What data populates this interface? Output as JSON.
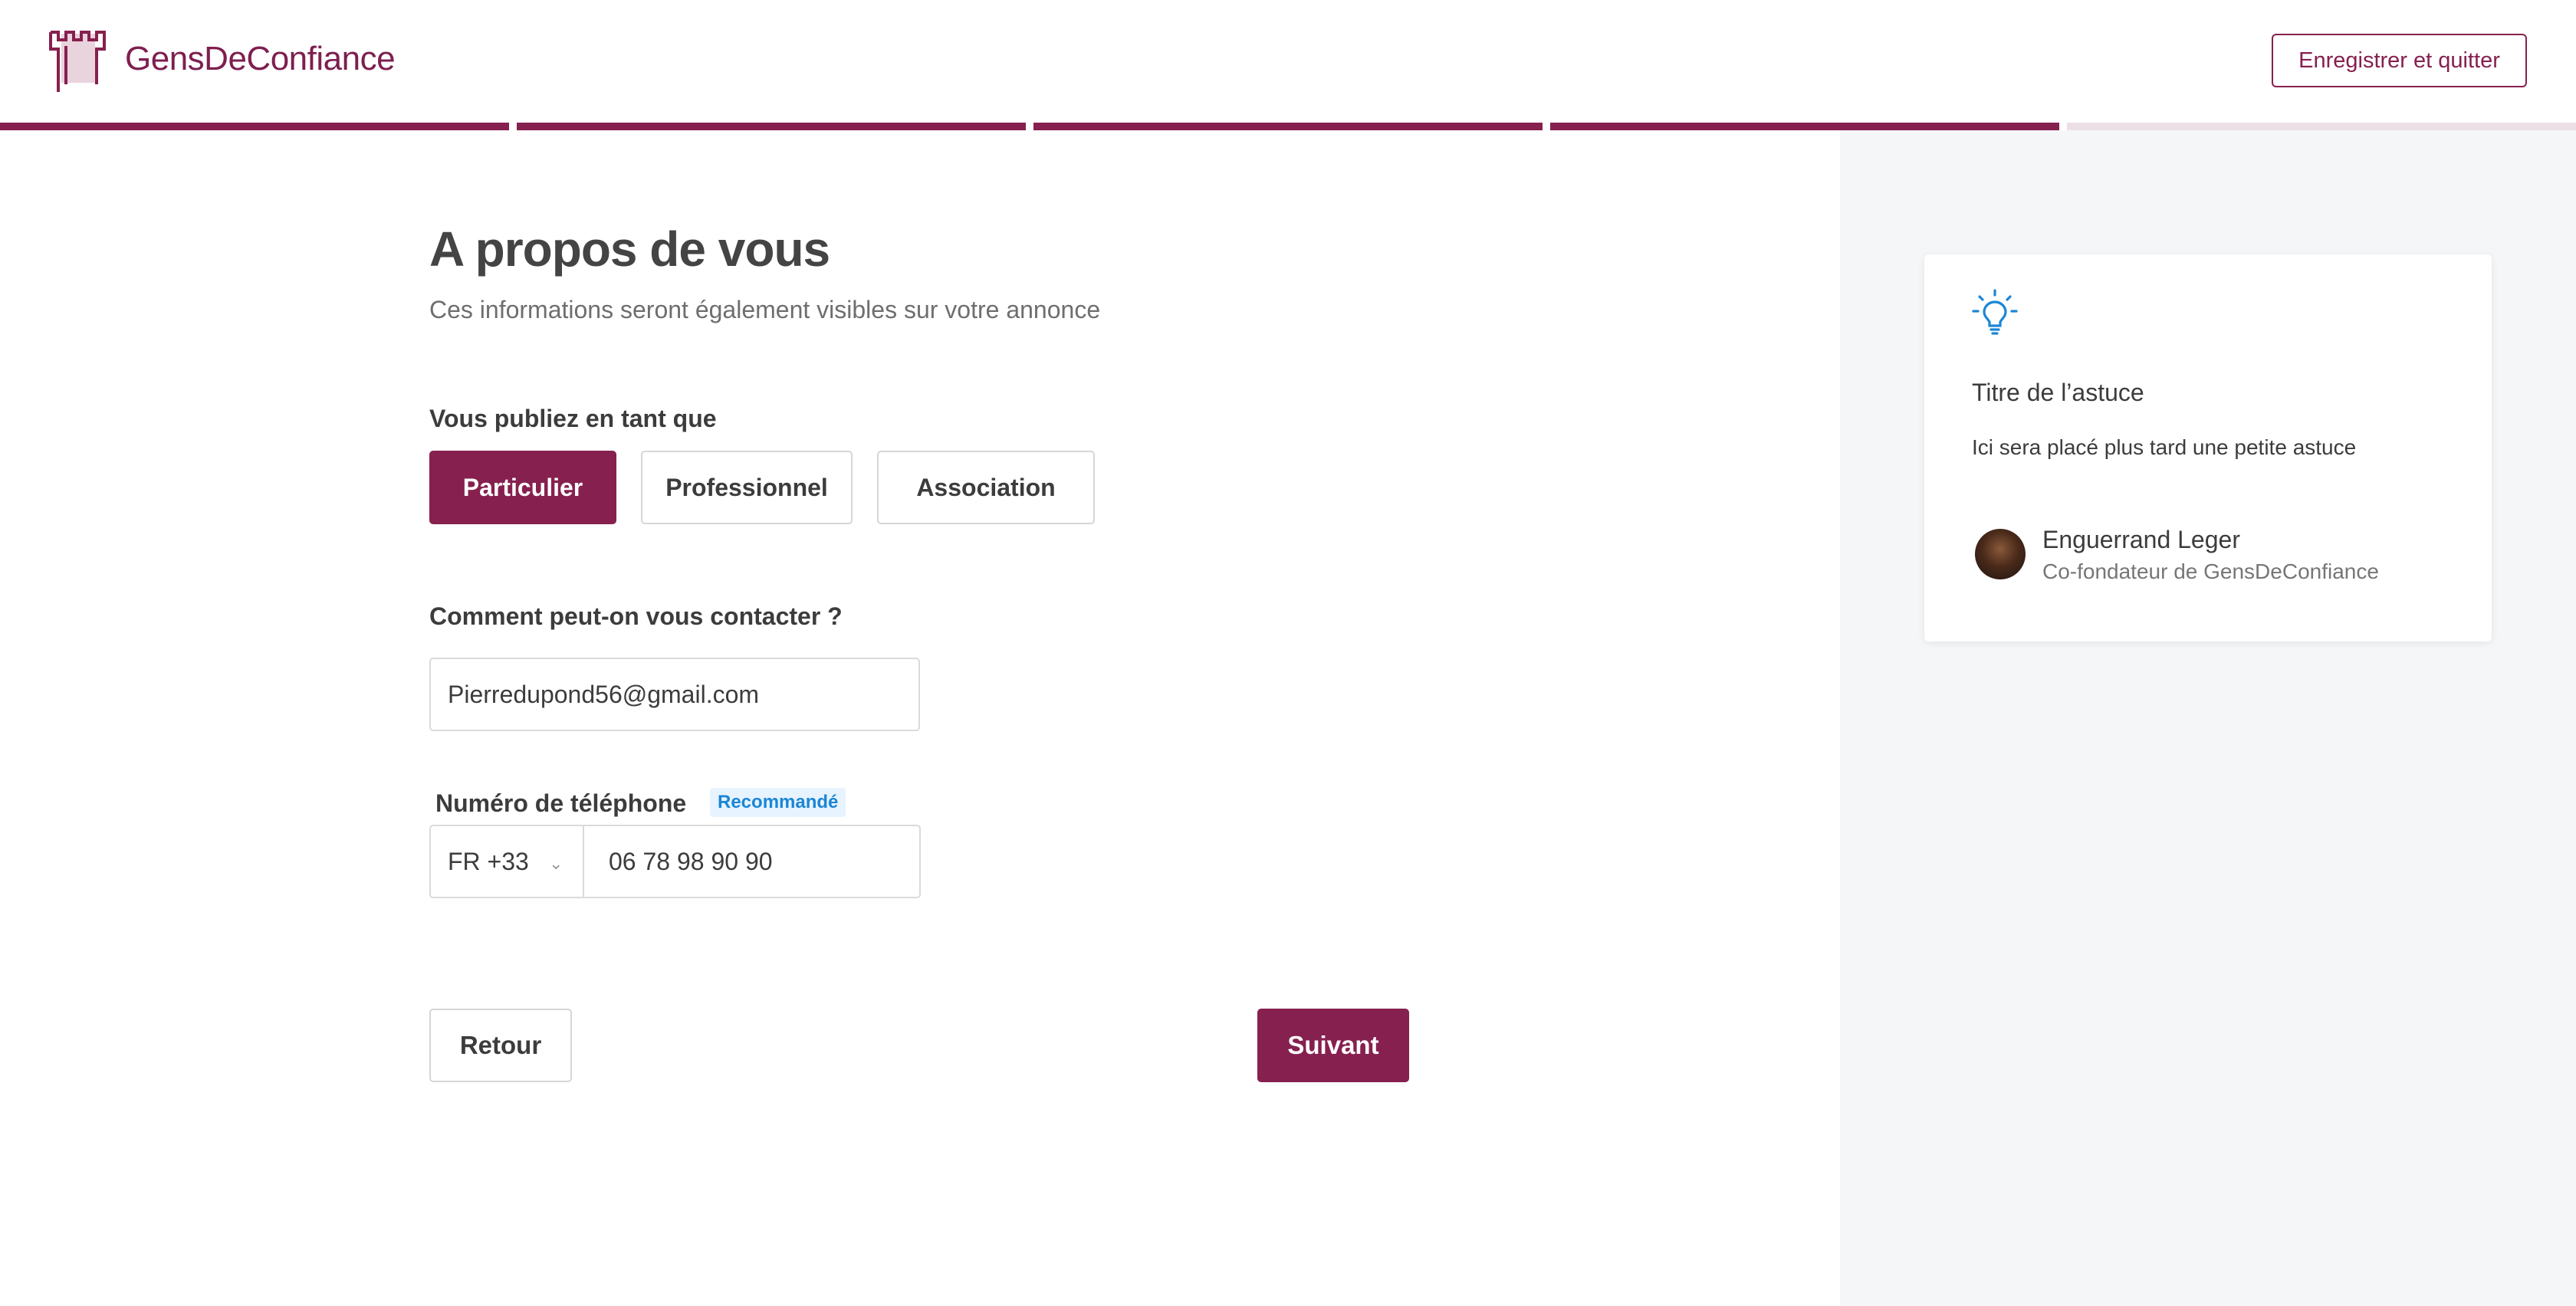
{
  "header": {
    "brand": "GensDeConfiance",
    "save_quit_label": "Enregistrer et quitter"
  },
  "progress": {
    "total_steps": 5,
    "completed_steps": 4,
    "color_done": "#86204f",
    "color_todo": "#ecdfe6"
  },
  "form": {
    "title": "A propos de vous",
    "subtitle": "Ces informations seront également visibles sur votre annonce",
    "publish_as_label": "Vous publiez en tant que",
    "publish_as_options": [
      "Particulier",
      "Professionnel",
      "Association"
    ],
    "publish_as_selected": "Particulier",
    "contact_label": "Comment peut-on vous contacter ?",
    "email_value": "Pierredupond56@gmail.com",
    "phone_label": "Numéro de téléphone",
    "phone_badge": "Recommandé",
    "country_code": "FR +33",
    "phone_value": "06 78 98 90 90",
    "back_label": "Retour",
    "next_label": "Suivant"
  },
  "tip": {
    "icon": "lightbulb-icon",
    "title": "Titre de l’astuce",
    "text": "Ici sera placé plus tard une petite astuce",
    "author_name": "Enguerrand Leger",
    "author_role": "Co-fondateur de GensDeConfiance"
  },
  "colors": {
    "brand": "#86204f",
    "accent_blue": "#1a86d6",
    "panel_bg": "#f5f6f8"
  }
}
